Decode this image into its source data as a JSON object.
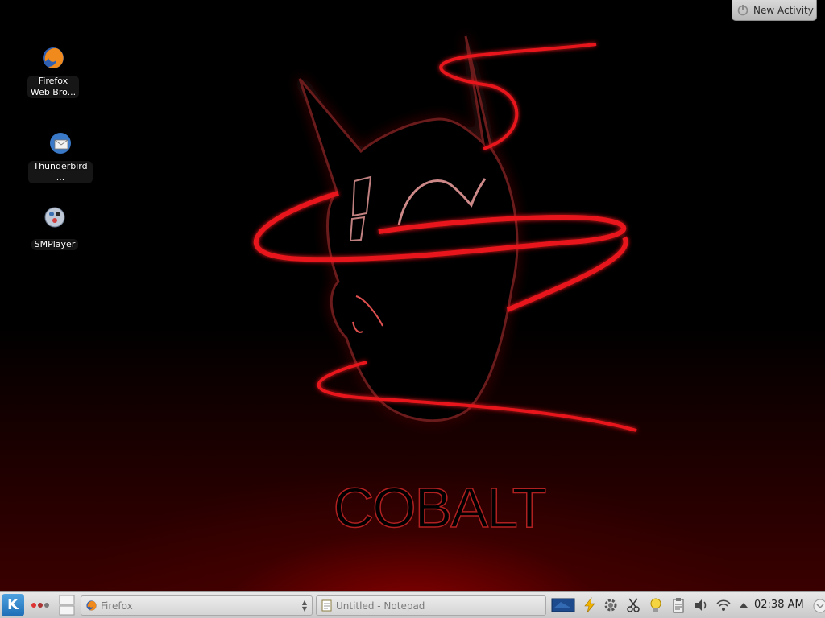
{
  "desktop": {
    "wallpaper_text": "COBALT",
    "icons": [
      {
        "label_line1": "Firefox",
        "label_line2": "Web Bro...",
        "icon": "firefox-icon"
      },
      {
        "label_line1": "Thunderbird ...",
        "icon": "thunderbird-icon"
      },
      {
        "label_line1": "SMPlayer",
        "icon": "smplayer-icon"
      }
    ]
  },
  "activity": {
    "label": "New Activity"
  },
  "taskbar": {
    "tasks": [
      {
        "label": "Firefox",
        "icon": "firefox-icon"
      },
      {
        "label": "Untitled - Notepad",
        "icon": "notepad-icon"
      }
    ],
    "tray_icons": [
      "display-icon",
      "power-icon",
      "gear-icon",
      "scissors-icon",
      "lightbulb-icon",
      "clipboard-icon",
      "volume-icon",
      "wifi-icon",
      "up-arrow-icon"
    ],
    "clock": "02:38 AM"
  },
  "colors": {
    "accent_red": "#e8191c",
    "taskbar": "#d8d8d8"
  }
}
